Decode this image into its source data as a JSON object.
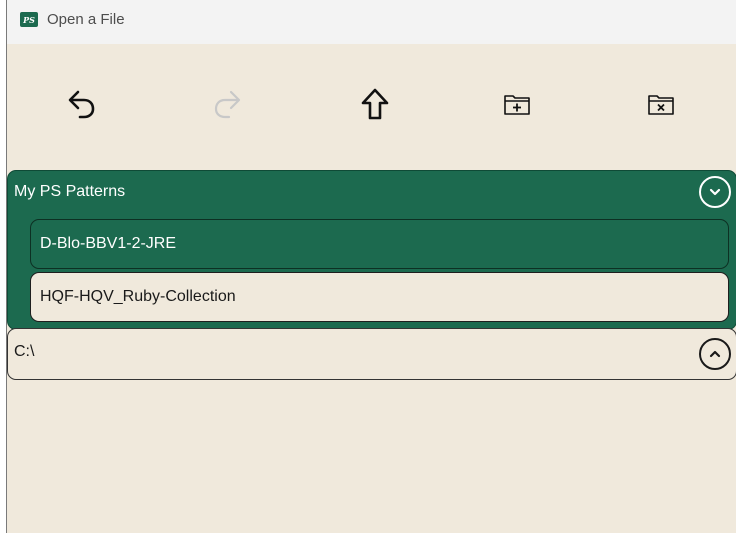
{
  "window": {
    "title": "Open a File",
    "logo_text": "PS"
  },
  "toolbar": {
    "buttons": [
      {
        "name": "undo",
        "icon": "undo-icon",
        "enabled": true
      },
      {
        "name": "redo",
        "icon": "redo-icon",
        "enabled": false
      },
      {
        "name": "up",
        "icon": "arrow-up-icon",
        "enabled": true
      },
      {
        "name": "new-folder",
        "icon": "folder-plus-icon",
        "enabled": true
      },
      {
        "name": "delete-folder",
        "icon": "folder-x-icon",
        "enabled": true
      }
    ]
  },
  "folder_panel": {
    "title": "My PS Patterns",
    "expand_icon": "chevron-down-icon",
    "items": [
      {
        "label": "D-Blo-BBV1-2-JRE",
        "selected": true
      },
      {
        "label": "HQF-HQV_Ruby-Collection",
        "selected": false
      }
    ]
  },
  "drive_panel": {
    "label": "C:\\",
    "expand_icon": "chevron-up-icon"
  },
  "colors": {
    "accent": "#1c6a4f",
    "background": "#f0e9dc",
    "titlebar": "#f3f3f3"
  }
}
